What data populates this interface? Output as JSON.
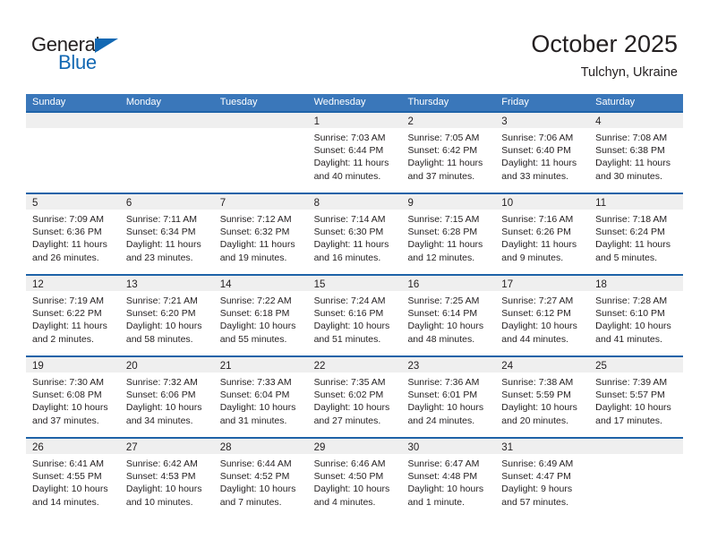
{
  "brand": {
    "name_top": "General",
    "name_bottom": "Blue",
    "triangle_color": "#1268b3",
    "text_color": "#231f20"
  },
  "header": {
    "title": "October 2025",
    "subtitle": "Tulchyn, Ukraine"
  },
  "theme": {
    "header_blue": "#3a77ba",
    "row_border_blue": "#1f63a8",
    "day_band_gray": "#efefef",
    "text": "#231f20"
  },
  "weekday_headers": [
    "Sunday",
    "Monday",
    "Tuesday",
    "Wednesday",
    "Thursday",
    "Friday",
    "Saturday"
  ],
  "weeks": [
    [
      {
        "day": "",
        "lines": []
      },
      {
        "day": "",
        "lines": []
      },
      {
        "day": "",
        "lines": []
      },
      {
        "day": "1",
        "lines": [
          "Sunrise: 7:03 AM",
          "Sunset: 6:44 PM",
          "Daylight: 11 hours",
          "and 40 minutes."
        ]
      },
      {
        "day": "2",
        "lines": [
          "Sunrise: 7:05 AM",
          "Sunset: 6:42 PM",
          "Daylight: 11 hours",
          "and 37 minutes."
        ]
      },
      {
        "day": "3",
        "lines": [
          "Sunrise: 7:06 AM",
          "Sunset: 6:40 PM",
          "Daylight: 11 hours",
          "and 33 minutes."
        ]
      },
      {
        "day": "4",
        "lines": [
          "Sunrise: 7:08 AM",
          "Sunset: 6:38 PM",
          "Daylight: 11 hours",
          "and 30 minutes."
        ]
      }
    ],
    [
      {
        "day": "5",
        "lines": [
          "Sunrise: 7:09 AM",
          "Sunset: 6:36 PM",
          "Daylight: 11 hours",
          "and 26 minutes."
        ]
      },
      {
        "day": "6",
        "lines": [
          "Sunrise: 7:11 AM",
          "Sunset: 6:34 PM",
          "Daylight: 11 hours",
          "and 23 minutes."
        ]
      },
      {
        "day": "7",
        "lines": [
          "Sunrise: 7:12 AM",
          "Sunset: 6:32 PM",
          "Daylight: 11 hours",
          "and 19 minutes."
        ]
      },
      {
        "day": "8",
        "lines": [
          "Sunrise: 7:14 AM",
          "Sunset: 6:30 PM",
          "Daylight: 11 hours",
          "and 16 minutes."
        ]
      },
      {
        "day": "9",
        "lines": [
          "Sunrise: 7:15 AM",
          "Sunset: 6:28 PM",
          "Daylight: 11 hours",
          "and 12 minutes."
        ]
      },
      {
        "day": "10",
        "lines": [
          "Sunrise: 7:16 AM",
          "Sunset: 6:26 PM",
          "Daylight: 11 hours",
          "and 9 minutes."
        ]
      },
      {
        "day": "11",
        "lines": [
          "Sunrise: 7:18 AM",
          "Sunset: 6:24 PM",
          "Daylight: 11 hours",
          "and 5 minutes."
        ]
      }
    ],
    [
      {
        "day": "12",
        "lines": [
          "Sunrise: 7:19 AM",
          "Sunset: 6:22 PM",
          "Daylight: 11 hours",
          "and 2 minutes."
        ]
      },
      {
        "day": "13",
        "lines": [
          "Sunrise: 7:21 AM",
          "Sunset: 6:20 PM",
          "Daylight: 10 hours",
          "and 58 minutes."
        ]
      },
      {
        "day": "14",
        "lines": [
          "Sunrise: 7:22 AM",
          "Sunset: 6:18 PM",
          "Daylight: 10 hours",
          "and 55 minutes."
        ]
      },
      {
        "day": "15",
        "lines": [
          "Sunrise: 7:24 AM",
          "Sunset: 6:16 PM",
          "Daylight: 10 hours",
          "and 51 minutes."
        ]
      },
      {
        "day": "16",
        "lines": [
          "Sunrise: 7:25 AM",
          "Sunset: 6:14 PM",
          "Daylight: 10 hours",
          "and 48 minutes."
        ]
      },
      {
        "day": "17",
        "lines": [
          "Sunrise: 7:27 AM",
          "Sunset: 6:12 PM",
          "Daylight: 10 hours",
          "and 44 minutes."
        ]
      },
      {
        "day": "18",
        "lines": [
          "Sunrise: 7:28 AM",
          "Sunset: 6:10 PM",
          "Daylight: 10 hours",
          "and 41 minutes."
        ]
      }
    ],
    [
      {
        "day": "19",
        "lines": [
          "Sunrise: 7:30 AM",
          "Sunset: 6:08 PM",
          "Daylight: 10 hours",
          "and 37 minutes."
        ]
      },
      {
        "day": "20",
        "lines": [
          "Sunrise: 7:32 AM",
          "Sunset: 6:06 PM",
          "Daylight: 10 hours",
          "and 34 minutes."
        ]
      },
      {
        "day": "21",
        "lines": [
          "Sunrise: 7:33 AM",
          "Sunset: 6:04 PM",
          "Daylight: 10 hours",
          "and 31 minutes."
        ]
      },
      {
        "day": "22",
        "lines": [
          "Sunrise: 7:35 AM",
          "Sunset: 6:02 PM",
          "Daylight: 10 hours",
          "and 27 minutes."
        ]
      },
      {
        "day": "23",
        "lines": [
          "Sunrise: 7:36 AM",
          "Sunset: 6:01 PM",
          "Daylight: 10 hours",
          "and 24 minutes."
        ]
      },
      {
        "day": "24",
        "lines": [
          "Sunrise: 7:38 AM",
          "Sunset: 5:59 PM",
          "Daylight: 10 hours",
          "and 20 minutes."
        ]
      },
      {
        "day": "25",
        "lines": [
          "Sunrise: 7:39 AM",
          "Sunset: 5:57 PM",
          "Daylight: 10 hours",
          "and 17 minutes."
        ]
      }
    ],
    [
      {
        "day": "26",
        "lines": [
          "Sunrise: 6:41 AM",
          "Sunset: 4:55 PM",
          "Daylight: 10 hours",
          "and 14 minutes."
        ]
      },
      {
        "day": "27",
        "lines": [
          "Sunrise: 6:42 AM",
          "Sunset: 4:53 PM",
          "Daylight: 10 hours",
          "and 10 minutes."
        ]
      },
      {
        "day": "28",
        "lines": [
          "Sunrise: 6:44 AM",
          "Sunset: 4:52 PM",
          "Daylight: 10 hours",
          "and 7 minutes."
        ]
      },
      {
        "day": "29",
        "lines": [
          "Sunrise: 6:46 AM",
          "Sunset: 4:50 PM",
          "Daylight: 10 hours",
          "and 4 minutes."
        ]
      },
      {
        "day": "30",
        "lines": [
          "Sunrise: 6:47 AM",
          "Sunset: 4:48 PM",
          "Daylight: 10 hours",
          "and 1 minute."
        ]
      },
      {
        "day": "31",
        "lines": [
          "Sunrise: 6:49 AM",
          "Sunset: 4:47 PM",
          "Daylight: 9 hours",
          "and 57 minutes."
        ]
      },
      {
        "day": "",
        "lines": []
      }
    ]
  ]
}
